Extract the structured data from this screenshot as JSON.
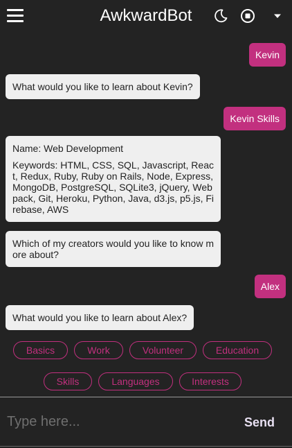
{
  "header": {
    "title": "AwkwardBot",
    "menu_icon": "hamburger-menu-icon",
    "theme_icon": "moon-icon",
    "stop_icon": "stop-circle-icon",
    "dropdown_icon": "caret-down-icon"
  },
  "messages": [
    {
      "from": "user",
      "text": "Kevin"
    },
    {
      "from": "bot",
      "text": "What would you like to learn about Kevin?"
    },
    {
      "from": "user",
      "text": "Kevin Skills"
    },
    {
      "from": "bot",
      "lines": [
        "Name: Web Development",
        "Keywords: HTML, CSS, SQL, Javascript, React, Redux, Ruby, Ruby on Rails, Node, Express, MongoDB, PostgreSQL, SQLite3, jQuery, Webpack, Git, Heroku, Python, Java, d3.js, p5.js, Firebase, AWS"
      ]
    },
    {
      "from": "bot",
      "text": "Which of my creators would you like to know more about?"
    },
    {
      "from": "user",
      "text": "Alex"
    },
    {
      "from": "bot",
      "text": "What would you like to learn about Alex?"
    }
  ],
  "quick_replies": [
    "Basics",
    "Work",
    "Volunteer",
    "Education",
    "Skills",
    "Languages",
    "Interests"
  ],
  "composer": {
    "placeholder": "Type here...",
    "send_label": "Send"
  },
  "colors": {
    "background": "#232323",
    "accent": "#c2307f",
    "bot_bubble": "#efefef"
  }
}
